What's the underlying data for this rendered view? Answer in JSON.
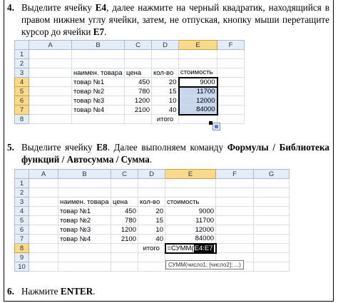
{
  "step4": {
    "num": "4.",
    "text_parts": [
      "Выделите ячейку ",
      "E4",
      ", далее нажмите на черный квадратик, находящийся в правом нижнем углу ячейки, затем, не отпуская, кнопку мыши перетащите курсор до ячейки ",
      "E7",
      "."
    ]
  },
  "step5": {
    "num": "5.",
    "text_parts": [
      "Выделите ячейку ",
      "E8",
      ". Далее выполняем команду ",
      "Формулы / Библиотека функций / Автосумма / Сумма",
      "."
    ]
  },
  "step6": {
    "num": "6.",
    "text_parts": [
      "Нажмите ",
      "ENTER",
      "."
    ]
  },
  "sheet1": {
    "columns": [
      "A",
      "B",
      "C",
      "D",
      "E",
      "F"
    ],
    "rows": [
      "1",
      "2",
      "3",
      "4",
      "5",
      "6",
      "7",
      "8"
    ],
    "headers": {
      "name": "наимен. товара",
      "price": "цена",
      "qty": "кол-во",
      "cost": "стоимость"
    },
    "items": [
      {
        "name": "товар №1",
        "price": "450",
        "qty": "20",
        "cost": "9000"
      },
      {
        "name": "товар №2",
        "price": "780",
        "qty": "15",
        "cost": "11700"
      },
      {
        "name": "товар №3",
        "price": "1200",
        "qty": "10",
        "cost": "12000"
      },
      {
        "name": "товар №4",
        "price": "2100",
        "qty": "40",
        "cost": "84000"
      }
    ],
    "total_label": "итого"
  },
  "sheet2": {
    "columns": [
      "A",
      "B",
      "C",
      "D",
      "E",
      "F",
      "G"
    ],
    "rows": [
      "1",
      "2",
      "3",
      "4",
      "5",
      "6",
      "7",
      "8",
      "9",
      "10"
    ],
    "headers": {
      "name": "наимен. товара",
      "price": "цена",
      "qty": "кол-во",
      "cost": "стоимость"
    },
    "items": [
      {
        "name": "товар №1",
        "price": "450",
        "qty": "20",
        "cost": "9000"
      },
      {
        "name": "товар №2",
        "price": "780",
        "qty": "15",
        "cost": "11700"
      },
      {
        "name": "товар №3",
        "price": "1200",
        "qty": "10",
        "cost": "12000"
      },
      {
        "name": "товар №4",
        "price": "2100",
        "qty": "40",
        "cost": "84000"
      }
    ],
    "total_label": "итого",
    "formula_prefix": "=СУММ(",
    "formula_ref": "E4:E7",
    "tooltip": "СУММ(число1; [число2]; ...)"
  }
}
